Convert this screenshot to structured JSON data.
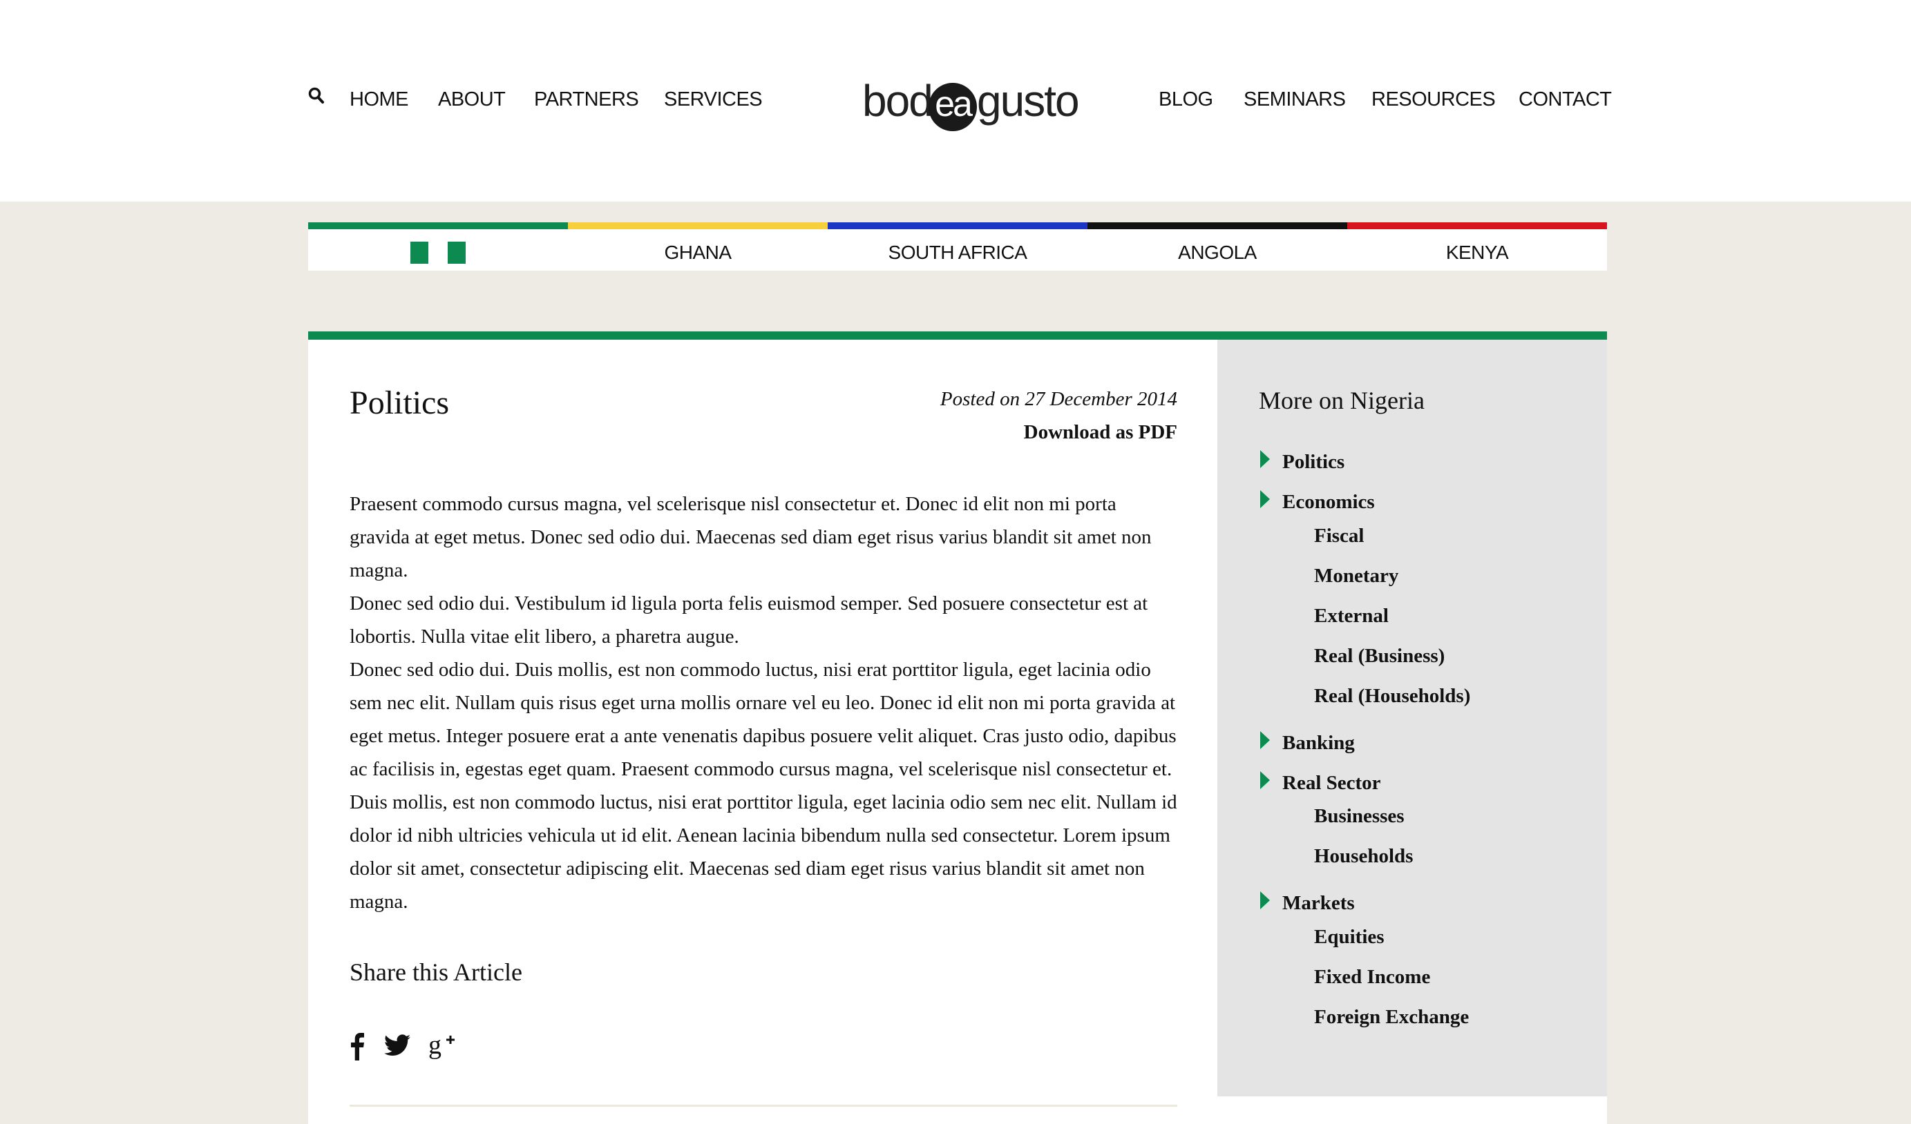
{
  "header": {
    "nav_left": [
      "HOME",
      "ABOUT",
      "PARTNERS",
      "SERVICES"
    ],
    "nav_right": [
      "BLOG",
      "SEMINARS",
      "RESOURCES",
      "CONTACT"
    ],
    "logo": {
      "part1": "bod",
      "part2": "ea",
      "part3": "gusto"
    }
  },
  "countries": [
    {
      "label": "",
      "color": "#0d8a4f"
    },
    {
      "label": "GHANA",
      "color": "#f7cf3a"
    },
    {
      "label": "SOUTH AFRICA",
      "color": "#1b35c4"
    },
    {
      "label": "ANGOLA",
      "color": "#111111"
    },
    {
      "label": "KENYA",
      "color": "#d9131d"
    }
  ],
  "article": {
    "title": "Politics",
    "posted": "Posted on 27 December 2014",
    "download": "Download as PDF",
    "paragraphs": [
      "Praesent commodo cursus magna, vel scelerisque nisl consectetur et. Donec id elit non mi porta gravida at eget metus. Donec sed odio dui. Maecenas sed diam eget risus varius blandit sit amet non magna.",
      "Donec sed odio dui. Vestibulum id ligula porta felis euismod semper. Sed posuere consectetur est at lobortis. Nulla vitae elit libero, a pharetra augue.",
      "Donec sed odio dui. Duis mollis, est non commodo luctus, nisi erat porttitor ligula, eget lacinia odio sem nec elit. Nullam quis risus eget urna mollis ornare vel eu leo. Donec id elit non mi porta gravida at eget metus. Integer posuere erat a ante venenatis dapibus posuere velit aliquet. Cras justo odio, dapibus ac facilisis in, egestas eget quam. Praesent commodo cursus magna, vel scelerisque nisl consectetur et. Duis mollis, est non commodo luctus, nisi erat porttitor ligula, eget lacinia odio sem nec elit. Nullam id dolor id nibh ultricies vehicula ut id elit. Aenean lacinia bibendum nulla sed consectetur. Lorem ipsum dolor sit amet, consectetur adipiscing elit. Maecenas sed diam eget risus varius blandit sit amet non magna."
    ],
    "share_title": "Share this Article",
    "share_icons": [
      "facebook-icon",
      "twitter-icon",
      "google-plus-icon"
    ]
  },
  "sidebar": {
    "title": "More on Nigeria",
    "sections": [
      {
        "label": "Politics",
        "children": []
      },
      {
        "label": "Economics",
        "children": [
          "Fiscal",
          "Monetary",
          "External",
          "Real (Business)",
          "Real (Households)"
        ]
      },
      {
        "label": "Banking",
        "children": []
      },
      {
        "label": "Real Sector",
        "children": [
          "Businesses",
          "Households"
        ]
      },
      {
        "label": "Markets",
        "children": [
          "Equities",
          "Fixed Income",
          "Foreign Exchange"
        ]
      }
    ]
  },
  "colors": {
    "accent_green": "#0d8a4f",
    "sidebar_bg": "#e4e4e4",
    "page_bg": "#eeebe4"
  }
}
